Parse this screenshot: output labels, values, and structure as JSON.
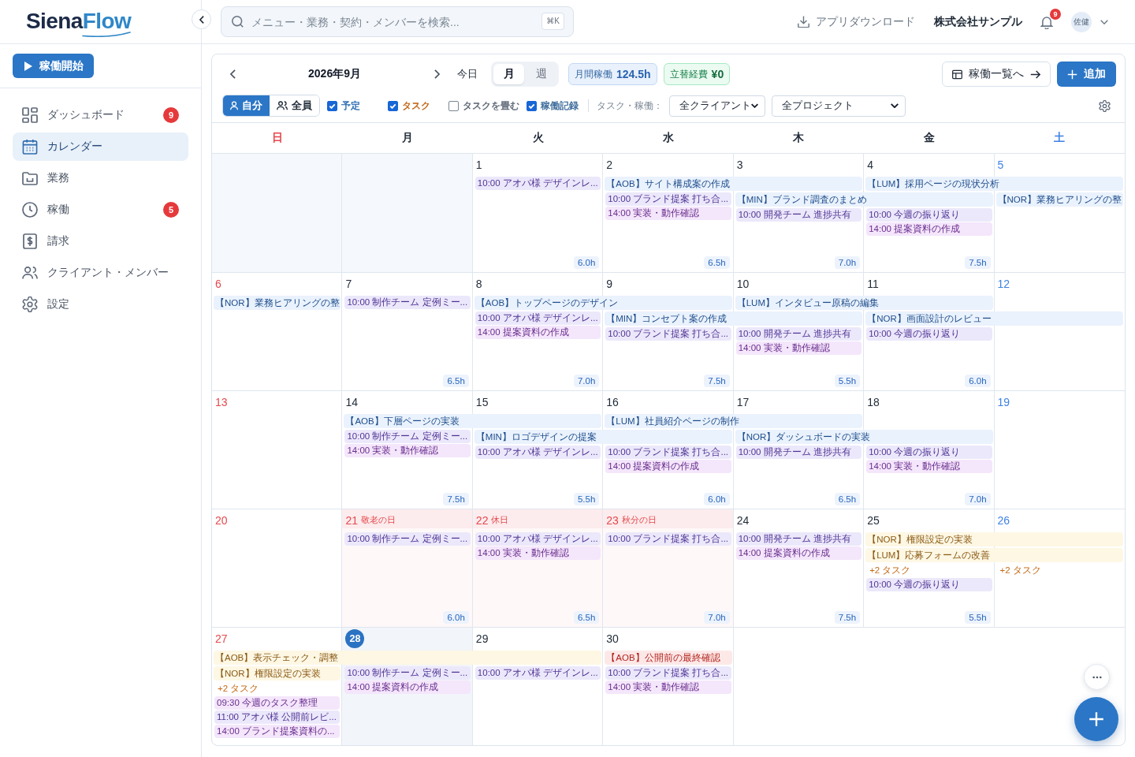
{
  "sidebar": {
    "logo": {
      "text": "Siena",
      "accent": "Flow"
    },
    "start_button": "稼働開始",
    "items": [
      {
        "label": "ダッシュボード",
        "badge": "9",
        "selected": false
      },
      {
        "label": "カレンダー",
        "selected": true
      },
      {
        "label": "業務",
        "selected": false
      },
      {
        "label": "稼働",
        "badge": "5",
        "selected": false
      },
      {
        "label": "請求",
        "selected": false
      },
      {
        "label": "クライアント・メンバー",
        "selected": false
      },
      {
        "label": "設定",
        "selected": false
      }
    ]
  },
  "topbar": {
    "search": {
      "placeholder": "メニュー・業務・契約・メンバーを検索...",
      "shortcut": "⌘K"
    },
    "download": "アプリダウンロード",
    "company": "株式会社サンプル",
    "notification_count": "9",
    "avatar": "佐健"
  },
  "toolbar": {
    "title": "2026年9月",
    "today_button": "今日",
    "views": [
      {
        "label": "月",
        "selected": true
      },
      {
        "label": "週",
        "selected": false
      }
    ],
    "stats": [
      {
        "kind": "hours",
        "label": "月間稼働",
        "value": "124.5h"
      },
      {
        "kind": "expense",
        "label": "立替経費",
        "value": "¥0"
      }
    ],
    "list_button": "稼働一覧へ",
    "add_button": "追加",
    "scope": [
      {
        "label": "自分",
        "selected": true
      },
      {
        "label": "全員",
        "selected": false
      }
    ],
    "filters": [
      {
        "label": "予定",
        "checked": true,
        "color": "#2b6cb0"
      },
      {
        "label": "タスク",
        "checked": true,
        "color": "#c2620f"
      },
      {
        "label": "タスクを畳む",
        "checked": false,
        "color": "#5b6573"
      },
      {
        "label": "稼働記録",
        "checked": true,
        "color": "#3b6a9a"
      }
    ],
    "filter_caption": "タスク・稼働：",
    "dropdowns": [
      "全クライアント",
      "全プロジェクト"
    ]
  },
  "calendar": {
    "weekdays": [
      {
        "label": "日",
        "kind": "sunday"
      },
      {
        "label": "月",
        "kind": "weekday"
      },
      {
        "label": "火",
        "kind": "weekday"
      },
      {
        "label": "水",
        "kind": "weekday"
      },
      {
        "label": "木",
        "kind": "weekday"
      },
      {
        "label": "金",
        "kind": "weekday"
      },
      {
        "label": "土",
        "kind": "saturday"
      }
    ],
    "weeks": [
      {
        "days": [
          {
            "kind": "blank"
          },
          {
            "kind": "blank"
          },
          {
            "date": "1",
            "kind": "weekday",
            "today": false,
            "events": [
              {
                "kind": "schedule",
                "text": "10:00 アオバ様 デザインレ..."
              }
            ],
            "hours": "6.0h"
          },
          {
            "date": "2",
            "kind": "weekday",
            "today": false,
            "bars": [
              {
                "kind": "task",
                "text": "【AOB】サイト構成案の作成",
                "continues": [
                  {
                    "kind": "day"
                  }
                ]
              }
            ],
            "events": [
              {
                "kind": "schedule",
                "text": "10:00 ブランド提案 打ち合..."
              },
              {
                "kind": "worklog",
                "text": "14:00 実装・動作確認"
              }
            ],
            "hours": "6.5h"
          },
          {
            "date": "3",
            "kind": "weekday",
            "today": false,
            "bars": [
              {
                "kind": "task",
                "text": "【MIN】ブランド調査のまとめ",
                "continues": [
                  {
                    "kind": "day"
                  }
                ]
              }
            ],
            "events": [
              {
                "kind": "schedule",
                "text": "10:00 開発チーム 進捗共有"
              }
            ],
            "hours": "7.0h"
          },
          {
            "date": "4",
            "kind": "weekday",
            "today": false,
            "bars": [
              {
                "kind": "task",
                "text": "【LUM】採用ページの現状分析",
                "continues": [
                  {
                    "kind": "day"
                  }
                ]
              }
            ],
            "events": [
              {
                "kind": "schedule",
                "text": "10:00 今週の振り返り"
              },
              {
                "kind": "worklog",
                "text": "14:00 提案資料の作成"
              }
            ],
            "hours": "7.5h"
          },
          {
            "date": "5",
            "kind": "saturday",
            "today": false,
            "bars": [
              {
                "kind": "task",
                "text": "【NOR】業務ヒアリングの整"
              }
            ]
          }
        ]
      },
      {
        "days": [
          {
            "date": "6",
            "kind": "sunday",
            "today": false,
            "bars": [
              {
                "kind": "task",
                "text": "【NOR】業務ヒアリングの整"
              }
            ]
          },
          {
            "date": "7",
            "kind": "weekday",
            "today": false,
            "events": [
              {
                "kind": "schedule",
                "text": "10:00 制作チーム 定例ミー..."
              }
            ],
            "hours": "6.5h"
          },
          {
            "date": "8",
            "kind": "weekday",
            "today": false,
            "bars": [
              {
                "kind": "task",
                "text": "【AOB】トップページのデザイン",
                "continues": [
                  {
                    "kind": "day"
                  }
                ]
              }
            ],
            "events": [
              {
                "kind": "schedule",
                "text": "10:00 アオバ様 デザインレ..."
              },
              {
                "kind": "worklog",
                "text": "14:00 提案資料の作成"
              }
            ],
            "hours": "7.0h"
          },
          {
            "date": "9",
            "kind": "weekday",
            "today": false,
            "bars": [
              {
                "kind": "task",
                "text": "【MIN】コンセプト案の作成",
                "continues": [
                  {
                    "kind": "day"
                  }
                ]
              }
            ],
            "events": [
              {
                "kind": "schedule",
                "text": "10:00 ブランド提案 打ち合..."
              }
            ],
            "hours": "7.5h"
          },
          {
            "date": "10",
            "kind": "weekday",
            "today": false,
            "bars": [
              {
                "kind": "task",
                "text": "【LUM】インタビュー原稿の編集",
                "continues": [
                  {
                    "kind": "day"
                  }
                ]
              }
            ],
            "events": [
              {
                "kind": "schedule",
                "text": "10:00 開発チーム 進捗共有"
              },
              {
                "kind": "worklog",
                "text": "14:00 実装・動作確認"
              }
            ],
            "hours": "5.5h"
          },
          {
            "date": "11",
            "kind": "weekday",
            "today": false,
            "bars": [
              {
                "kind": "task",
                "text": "【NOR】画面設計のレビュー",
                "continues": [
                  {
                    "kind": "day"
                  }
                ]
              }
            ],
            "events": [
              {
                "kind": "schedule",
                "text": "10:00 今週の振り返り"
              }
            ],
            "hours": "6.0h"
          },
          {
            "date": "12",
            "kind": "saturday",
            "today": false
          }
        ]
      },
      {
        "days": [
          {
            "date": "13",
            "kind": "sunday",
            "today": false
          },
          {
            "date": "14",
            "kind": "weekday",
            "today": false,
            "bars": [
              {
                "kind": "task",
                "text": "【AOB】下層ページの実装",
                "continues": [
                  {
                    "kind": "day"
                  }
                ]
              }
            ],
            "events": [
              {
                "kind": "schedule",
                "text": "10:00 制作チーム 定例ミー..."
              },
              {
                "kind": "worklog",
                "text": "14:00 実装・動作確認"
              }
            ],
            "hours": "7.5h"
          },
          {
            "date": "15",
            "kind": "weekday",
            "today": false,
            "bars": [
              {
                "kind": "task",
                "text": "【MIN】ロゴデザインの提案",
                "continues": [
                  {
                    "kind": "day"
                  }
                ]
              }
            ],
            "events": [
              {
                "kind": "schedule",
                "text": "10:00 アオバ様 デザインレ..."
              }
            ],
            "hours": "5.5h"
          },
          {
            "date": "16",
            "kind": "weekday",
            "today": false,
            "bars": [
              {
                "kind": "task",
                "text": "【LUM】社員紹介ページの制作",
                "continues": [
                  {
                    "kind": "day"
                  }
                ]
              }
            ],
            "events": [
              {
                "kind": "schedule",
                "text": "10:00 ブランド提案 打ち合..."
              },
              {
                "kind": "worklog",
                "text": "14:00 提案資料の作成"
              }
            ],
            "hours": "6.0h"
          },
          {
            "date": "17",
            "kind": "weekday",
            "today": false,
            "bars": [
              {
                "kind": "task",
                "text": "【NOR】ダッシュボードの実装",
                "continues": [
                  {
                    "kind": "day"
                  }
                ]
              }
            ],
            "events": [
              {
                "kind": "schedule",
                "text": "10:00 開発チーム 進捗共有"
              }
            ],
            "hours": "6.5h"
          },
          {
            "date": "18",
            "kind": "weekday",
            "today": false,
            "events": [
              {
                "kind": "schedule",
                "text": "10:00 今週の振り返り"
              },
              {
                "kind": "worklog",
                "text": "14:00 実装・動作確認"
              }
            ],
            "hours": "7.0h"
          },
          {
            "date": "19",
            "kind": "saturday",
            "today": false
          }
        ]
      },
      {
        "days": [
          {
            "date": "20",
            "kind": "sunday",
            "today": false
          },
          {
            "date": "21",
            "kind": "holiday",
            "holiday": "敬老の日",
            "today": false,
            "events": [
              {
                "kind": "schedule",
                "text": "10:00 制作チーム 定例ミー..."
              }
            ],
            "hours": "6.0h"
          },
          {
            "date": "22",
            "kind": "holiday",
            "holiday": "休日",
            "today": false,
            "events": [
              {
                "kind": "schedule",
                "text": "10:00 アオバ様 デザインレ..."
              },
              {
                "kind": "worklog",
                "text": "14:00 実装・動作確認"
              }
            ],
            "hours": "6.5h"
          },
          {
            "date": "23",
            "kind": "holiday",
            "holiday": "秋分の日",
            "today": false,
            "events": [
              {
                "kind": "schedule",
                "text": "10:00 ブランド提案 打ち合..."
              }
            ],
            "hours": "7.0h"
          },
          {
            "date": "24",
            "kind": "weekday",
            "today": false,
            "events": [
              {
                "kind": "schedule",
                "text": "10:00 開発チーム 進捗共有"
              },
              {
                "kind": "worklog",
                "text": "14:00 提案資料の作成"
              }
            ],
            "hours": "7.5h"
          },
          {
            "date": "25",
            "kind": "weekday",
            "today": false,
            "bars": [
              {
                "kind": "upcoming",
                "text": "【NOR】権限設定の実装",
                "continues": [
                  {
                    "kind": "day"
                  }
                ]
              },
              {
                "kind": "upcoming",
                "text": "【LUM】応募フォームの改善",
                "continues": [
                  {
                    "kind": "day"
                  }
                ]
              }
            ],
            "more": "+2 タスク",
            "events": [
              {
                "kind": "schedule",
                "text": "10:00 今週の振り返り"
              }
            ],
            "hours": "5.5h"
          },
          {
            "date": "26",
            "kind": "saturday",
            "today": false,
            "more": "+2 タスク"
          }
        ]
      },
      {
        "days": [
          {
            "date": "27",
            "kind": "sunday",
            "today": false,
            "bars": [
              {
                "kind": "upcoming",
                "text": "【AOB】表示チェック・調整",
                "continues": [
                  {
                    "kind": "day"
                  },
                  {
                    "kind": "day"
                  }
                ]
              },
              {
                "kind": "upcoming",
                "text": "【NOR】権限設定の実装"
              }
            ],
            "more": "+2 タスク",
            "events": [
              {
                "kind": "worklog",
                "text": "09:30 今週のタスク整理"
              },
              {
                "kind": "schedule",
                "text": "11:00 アオバ様 公開前レビ..."
              },
              {
                "kind": "worklog",
                "text": "14:00 ブランド提案資料の..."
              }
            ]
          },
          {
            "date": "28",
            "kind": "weekday",
            "today": true,
            "events": [
              {
                "kind": "schedule",
                "text": "10:00 制作チーム 定例ミー..."
              },
              {
                "kind": "worklog",
                "text": "14:00 提案資料の作成"
              }
            ]
          },
          {
            "date": "29",
            "kind": "weekday",
            "today": false,
            "events": [
              {
                "kind": "schedule",
                "text": "10:00 アオバ様 デザインレ..."
              }
            ]
          },
          {
            "date": "30",
            "kind": "weekday",
            "today": false,
            "bars": [
              {
                "kind": "urgent",
                "text": "【AOB】公開前の最終確認"
              }
            ],
            "events": [
              {
                "kind": "schedule",
                "text": "10:00 ブランド提案 打ち合..."
              },
              {
                "kind": "worklog",
                "text": "14:00 実装・動作確認"
              }
            ]
          }
        ]
      }
    ]
  }
}
